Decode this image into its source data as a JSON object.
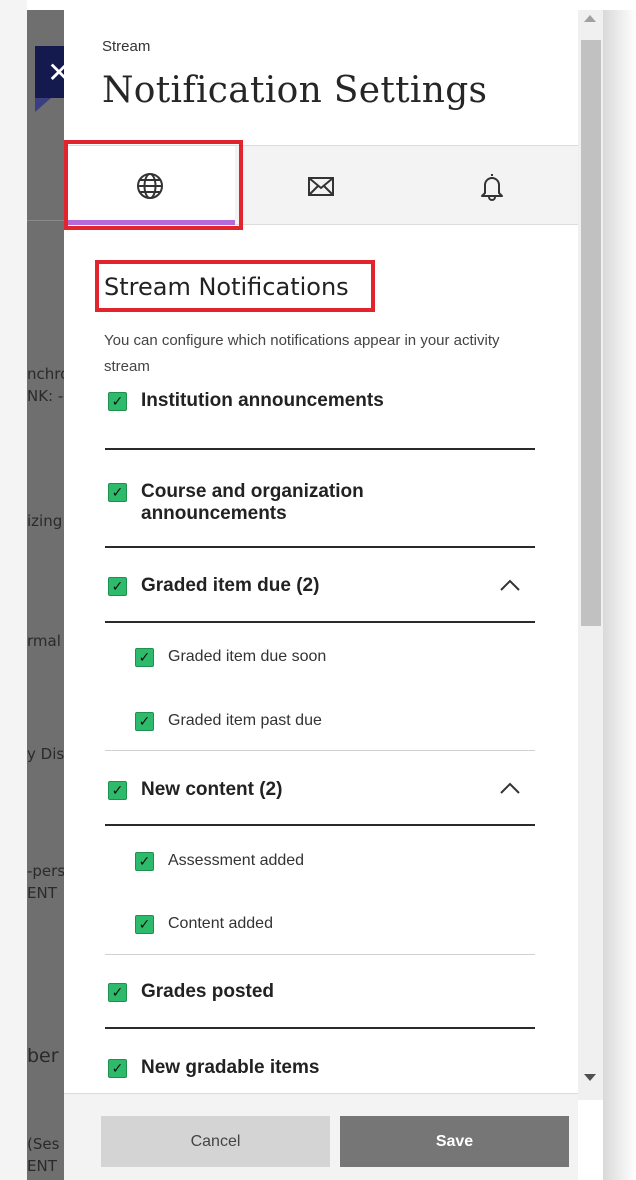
{
  "background": {
    "fragments": [
      "nchro",
      "NK: -",
      "izing",
      "rmal",
      "y Dis",
      "-pers",
      "ENT",
      "ber",
      "(Ses",
      "ENT"
    ]
  },
  "close_button": {
    "label": "✕"
  },
  "header": {
    "subtitle": "Stream",
    "title": "Notification Settings"
  },
  "tabs": [
    {
      "name": "stream",
      "icon": "globe-icon",
      "active": true
    },
    {
      "name": "email",
      "icon": "envelope-icon",
      "active": false
    },
    {
      "name": "push",
      "icon": "bell-icon",
      "active": false
    }
  ],
  "section": {
    "title": "Stream Notifications",
    "description": "You can configure which notifications appear in your activity stream"
  },
  "items": [
    {
      "label": "Institution announcements",
      "checked": true,
      "level": 0
    },
    {
      "label": "Course and organization announcements",
      "checked": true,
      "level": 0
    },
    {
      "label": "Graded item due (2)",
      "checked": true,
      "level": 0,
      "expanded": true
    },
    {
      "label": "Graded item due soon",
      "checked": true,
      "level": 1
    },
    {
      "label": "Graded item past due",
      "checked": true,
      "level": 1
    },
    {
      "label": "New content (2)",
      "checked": true,
      "level": 0,
      "expanded": true
    },
    {
      "label": "Assessment added",
      "checked": true,
      "level": 1
    },
    {
      "label": "Content added",
      "checked": true,
      "level": 1
    },
    {
      "label": "Grades posted",
      "checked": true,
      "level": 0
    },
    {
      "label": "New gradable items",
      "checked": true,
      "level": 0
    }
  ],
  "footer": {
    "cancel_label": "Cancel",
    "save_label": "Save"
  },
  "colors": {
    "accent": "#b56ad8",
    "checkbox": "#2dbb6b",
    "highlight": "#e2242c",
    "close_bg": "#141a4e"
  }
}
